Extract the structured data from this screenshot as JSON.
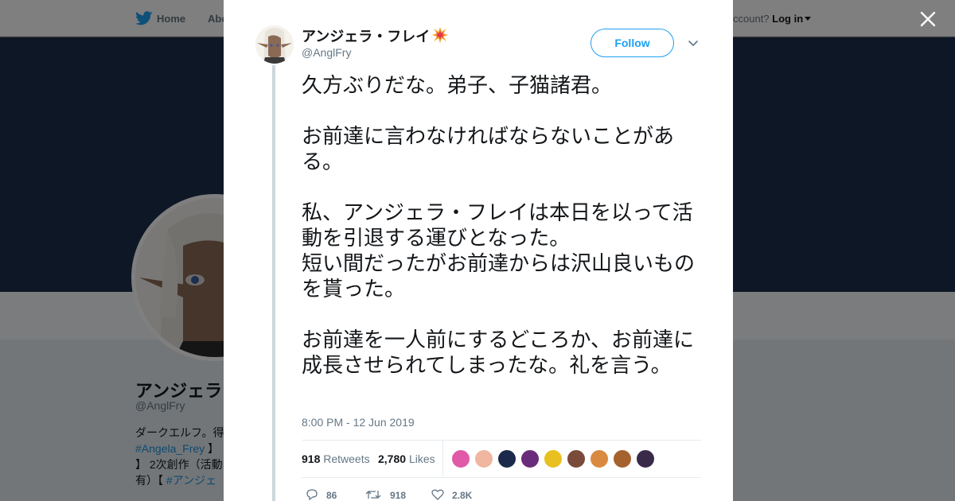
{
  "background": {
    "nav": {
      "home_label": "Home",
      "about_label": "Abo",
      "account_prompt": "ccount?",
      "login_label": "Log in"
    },
    "profile": {
      "name": "アンジェラ",
      "handle": "@AnglFry",
      "bio_line1": "ダークエルフ。得",
      "bio_tag1": "#Angela_Frey",
      "bio_after_tag1": " 】",
      "bio_line3": "】 2次創作（活動",
      "bio_line4_prefix": "有）【 ",
      "bio_tag2": "#アンジェ"
    },
    "colors": {
      "banner": "#1d2f4a",
      "accent": "#1da1f2"
    }
  },
  "modal": {
    "close_icon": "close-icon",
    "author": {
      "name": "アンジェラ・フレイ",
      "name_emoji": "collision-icon",
      "handle": "@AnglFry"
    },
    "follow_label": "Follow",
    "tweet_text": "久方ぶりだな。弟子、子猫諸君。\n\nお前達に言わなければならないことがある。\n\n私、アンジェラ・フレイは本日を以って活動を引退する運びとなった。\n短い間だったがお前達からは沢山良いものを貰った。\n\nお前達を一人前にするどころか、お前達に成長させられてしまったな。礼を言う。",
    "timestamp": "8:00 PM - 12 Jun 2019",
    "stats": {
      "retweets_count": "918",
      "retweets_label": "Retweets",
      "likes_count": "2,780",
      "likes_label": "Likes"
    },
    "likers": [
      {
        "name": "liker-avatar-1",
        "color": "#e05aa8"
      },
      {
        "name": "liker-avatar-2",
        "color": "#f0b6a0"
      },
      {
        "name": "liker-avatar-3",
        "color": "#1b2a4a"
      },
      {
        "name": "liker-avatar-4",
        "color": "#6a2c7a"
      },
      {
        "name": "liker-avatar-5",
        "color": "#e8c020"
      },
      {
        "name": "liker-avatar-6",
        "color": "#7a4a3a"
      },
      {
        "name": "liker-avatar-7",
        "color": "#d98a40"
      },
      {
        "name": "liker-avatar-8",
        "color": "#a5622e"
      },
      {
        "name": "liker-avatar-9",
        "color": "#3a2a4a"
      }
    ],
    "actions": {
      "reply_count": "86",
      "retweet_count": "918",
      "like_count": "2.8K"
    }
  }
}
